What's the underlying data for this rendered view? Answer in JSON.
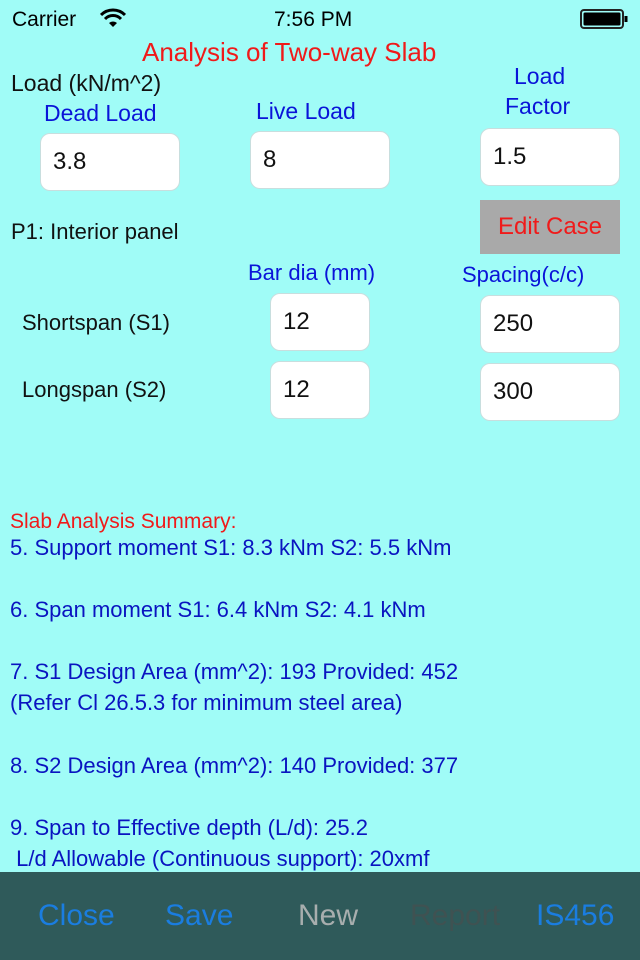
{
  "status_bar": {
    "carrier": "Carrier",
    "time": "7:56 PM",
    "wifi_icon": "wifi-icon",
    "battery_icon": "battery-icon"
  },
  "title": "Analysis of Two-way Slab",
  "load": {
    "section_label": "Load (kN/m^2)",
    "dead_load_label": "Dead Load",
    "live_load_label": "Live Load",
    "load_factor_label_line1": "Load",
    "load_factor_label_line2": "Factor",
    "dead_load_value": "3.8",
    "live_load_value": "8",
    "load_factor_value": "1.5"
  },
  "panel": {
    "case_label": "P1: Interior panel",
    "edit_case_button": "Edit Case"
  },
  "reinforcement": {
    "bar_dia_header": "Bar dia (mm)",
    "spacing_header": "Spacing(c/c)",
    "rows": [
      {
        "label": "Shortspan (S1)",
        "bar_dia": "12",
        "spacing": "250"
      },
      {
        "label": "Longspan (S2)",
        "bar_dia": "12",
        "spacing": "300"
      }
    ]
  },
  "summary": {
    "heading": "Slab Analysis Summary:",
    "lines": [
      "5. Support moment S1: 8.3 kNm  S2: 5.5 kNm",
      "6. Span moment S1: 6.4 kNm  S2: 4.1 kNm",
      "7. S1 Design Area (mm^2): 193 Provided: 452",
      "(Refer Cl 26.5.3 for minimum steel area)",
      "8. S2 Design Area (mm^2): 140 Provided: 377",
      "9. Span to Effective depth (L/d): 25.2",
      " L/d Allowable (Continuous support): 20xmf"
    ]
  },
  "toolbar": {
    "close": "Close",
    "save": "Save",
    "new": "New",
    "report": "Report",
    "is456": "IS456"
  },
  "colors": {
    "background": "#a0fcf7",
    "title_red": "#f01a1a",
    "label_blue": "#0a14d8",
    "toolbar_bg": "#2f5a5a",
    "toolbar_tint": "#1a7de0"
  }
}
